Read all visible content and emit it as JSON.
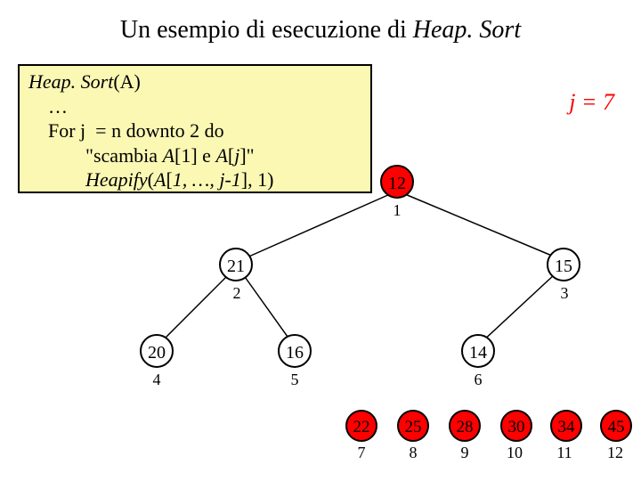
{
  "title_prefix": "Un esempio di esecuzione di ",
  "title_ital": "Heap. Sort",
  "code": {
    "line1_ital": "Heap. Sort",
    "line1_rest": "(A)",
    "line2": "…",
    "line3": "For j  = n downto 2 do",
    "line4_prefix": "\"scambia ",
    "line4_a1": "A",
    "line4_mid1": "[1] e ",
    "line4_a2": "A",
    "line4_mid2": "[",
    "line4_j": "j",
    "line4_end": "]\"",
    "line5_ital": "Heapify",
    "line5_paren": "(",
    "line5_arg_ital": "A",
    "line5_arg2": "[",
    "line5_arg_ital2": "1, …, j-1",
    "line5_arg3": "], 1)"
  },
  "j_label": "j = 7",
  "nodes": {
    "n1": "12",
    "n2": "21",
    "n3": "15",
    "n4": "20",
    "n5": "16",
    "n6": "14",
    "n7": "22",
    "n8": "25",
    "n9": "28",
    "n10": "30",
    "n11": "34",
    "n12": "45"
  },
  "idx": {
    "i1": "1",
    "i2": "2",
    "i3": "3",
    "i4": "4",
    "i5": "5",
    "i6": "6",
    "i7": "7",
    "i8": "8",
    "i9": "9",
    "i10": "10",
    "i11": "11",
    "i12": "12"
  },
  "chart_data": {
    "type": "tree",
    "title": "Heap state during HeapSort, j = 7",
    "nodes": [
      {
        "index": 1,
        "value": 12,
        "color": "red"
      },
      {
        "index": 2,
        "value": 21,
        "color": "white"
      },
      {
        "index": 3,
        "value": 15,
        "color": "white"
      },
      {
        "index": 4,
        "value": 20,
        "color": "white"
      },
      {
        "index": 5,
        "value": 16,
        "color": "white"
      },
      {
        "index": 6,
        "value": 14,
        "color": "white"
      },
      {
        "index": 7,
        "value": 22,
        "color": "red"
      },
      {
        "index": 8,
        "value": 25,
        "color": "red"
      },
      {
        "index": 9,
        "value": 28,
        "color": "red"
      },
      {
        "index": 10,
        "value": 30,
        "color": "red"
      },
      {
        "index": 11,
        "value": 34,
        "color": "red"
      },
      {
        "index": 12,
        "value": 45,
        "color": "red"
      }
    ],
    "edges": [
      [
        1,
        2
      ],
      [
        1,
        3
      ],
      [
        2,
        4
      ],
      [
        2,
        5
      ],
      [
        3,
        6
      ]
    ],
    "annotations": [
      "j = 7"
    ]
  }
}
